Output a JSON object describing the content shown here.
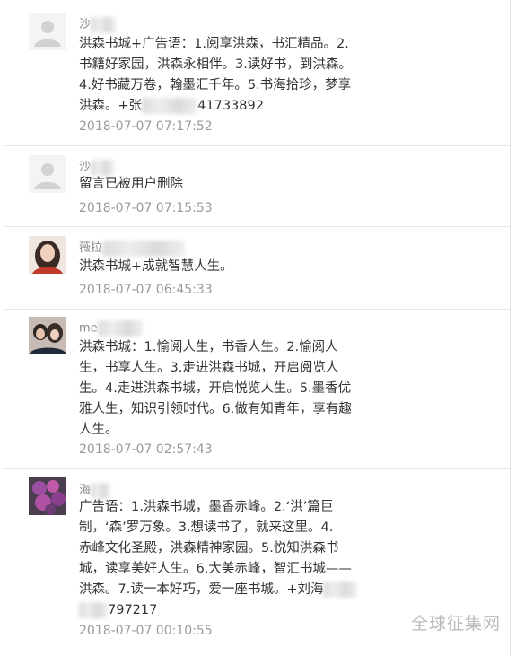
{
  "comments": [
    {
      "name": "沙",
      "lines": [
        "洪森书城+广告语：1.阅享洪森，书汇精品。2.",
        "书籍好家园，洪森永相伴。3.读好书，到洪森。",
        "4.好书藏万卷，翰墨汇千年。5.书海拾珍，梦享",
        "洪森。+张"
      ],
      "line_tail": "41733892",
      "time": "2018-07-07 07:17:52",
      "avatar": "default-avatar"
    },
    {
      "name": "沙",
      "lines": [
        "留言已被用户删除"
      ],
      "time": "2018-07-07 07:15:53",
      "avatar": "default-avatar"
    },
    {
      "name": "薇拉",
      "lines": [
        "洪森书城+成就智慧人生。"
      ],
      "time": "2018-07-07 06:45:33",
      "avatar": "woman-photo-avatar"
    },
    {
      "name": "me",
      "lines": [
        "洪森书城：1.愉阅人生，书香人生。2.愉阅人",
        "生，书享人生。3.走进洪森书城，开启阅览人",
        "生。4.走进洪森书城，开启悦览人生。5.墨香优",
        "雅人生，知识引领时代。6.做有知青年，享有趣",
        "人生。"
      ],
      "time": "2018-07-07 02:57:43",
      "avatar": "couple-photo-avatar"
    },
    {
      "name": "海",
      "lines": [
        "广告语：1.洪森书城，墨香赤峰。2.‘洪’篇巨",
        "制，‘森’罗万象。3.想读书了，就来这里。4.",
        "赤峰文化圣殿，洪森精神家园。5.悦知洪森书",
        "城，读享美好人生。6.大美赤峰，智汇书城——",
        "洪森。7.读一本好巧，爱一座书城。+刘海"
      ],
      "line_tail": "797217",
      "time": "2018-07-07 00:10:55",
      "avatar": "flower-photo-avatar"
    }
  ],
  "watermark": "全球征集网",
  "colors": {
    "text": "#333333",
    "meta": "#9a9a9a",
    "divider": "#e6e6e6"
  }
}
